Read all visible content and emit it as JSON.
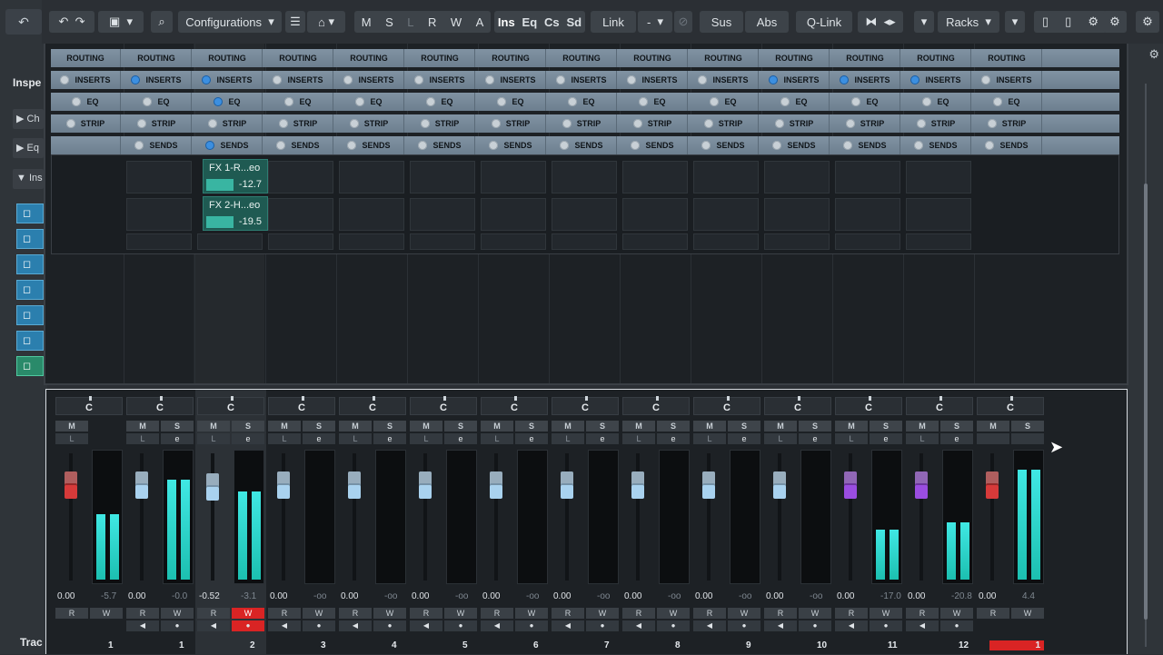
{
  "toolbar": {
    "configurations": "Configurations",
    "mode_buttons": [
      "M",
      "S",
      "L",
      "R",
      "W",
      "A"
    ],
    "view_buttons": [
      "Ins",
      "Eq",
      "Cs",
      "Sd"
    ],
    "link": "Link",
    "link_value": "-",
    "sus": "Sus",
    "abs": "Abs",
    "qlink": "Q-Link",
    "racks": "Racks"
  },
  "left_panel": {
    "title": "Inspe",
    "sections": [
      "Ch",
      "Eq",
      "Ins"
    ],
    "footer": "Trac"
  },
  "rack": {
    "routing": "ROUTING",
    "inserts": "INSERTS",
    "eq": "EQ",
    "strip": "STRIP",
    "sends": "SENDS",
    "inserts_active": [
      1,
      2,
      10,
      11,
      12
    ],
    "eq_active": [
      2
    ],
    "sends_active": [
      2
    ]
  },
  "sends": [
    {
      "name": "FX 1-R...eo",
      "value": "-12.7"
    },
    {
      "name": "FX 2-H...eo",
      "value": "-19.5"
    }
  ],
  "channels": [
    {
      "pan": "C",
      "volume": "0.00",
      "peak": "-5.7",
      "num": "1",
      "fader": "red",
      "meter": 0.52
    },
    {
      "pan": "C",
      "volume": "0.00",
      "peak": "-0.0",
      "num": "1",
      "fader": "blue",
      "meter": 0.8
    },
    {
      "pan": "C",
      "volume": "-0.52",
      "peak": "-3.1",
      "num": "2",
      "fader": "blue",
      "meter": 0.7
    },
    {
      "pan": "C",
      "volume": "0.00",
      "peak": "-oo",
      "num": "3",
      "fader": "blue",
      "meter": 0
    },
    {
      "pan": "C",
      "volume": "0.00",
      "peak": "-oo",
      "num": "4",
      "fader": "blue",
      "meter": 0
    },
    {
      "pan": "C",
      "volume": "0.00",
      "peak": "-oo",
      "num": "5",
      "fader": "blue",
      "meter": 0
    },
    {
      "pan": "C",
      "volume": "0.00",
      "peak": "-oo",
      "num": "6",
      "fader": "blue",
      "meter": 0
    },
    {
      "pan": "C",
      "volume": "0.00",
      "peak": "-oo",
      "num": "7",
      "fader": "blue",
      "meter": 0
    },
    {
      "pan": "C",
      "volume": "0.00",
      "peak": "-oo",
      "num": "8",
      "fader": "blue",
      "meter": 0
    },
    {
      "pan": "C",
      "volume": "0.00",
      "peak": "-oo",
      "num": "9",
      "fader": "blue",
      "meter": 0
    },
    {
      "pan": "C",
      "volume": "0.00",
      "peak": "-oo",
      "num": "10",
      "fader": "blue",
      "meter": 0
    },
    {
      "pan": "C",
      "volume": "0.00",
      "peak": "-17.0",
      "num": "11",
      "fader": "purple",
      "meter": 0.4
    },
    {
      "pan": "C",
      "volume": "0.00",
      "peak": "-20.8",
      "num": "12",
      "fader": "purple",
      "meter": 0.46
    },
    {
      "pan": "C",
      "volume": "0.00",
      "peak": "4.4",
      "num": "1",
      "fader": "red",
      "meter": 0.88
    }
  ],
  "labels": {
    "mute": "M",
    "solo": "S",
    "listen": "L",
    "read": "R",
    "write": "W",
    "edit": "e"
  },
  "colors": {
    "fader_red": "#d63a3a",
    "fader_blue": "#a9d2ef",
    "fader_purple": "#9a4de0",
    "meter": "#2fd9d0",
    "record": "#d92424",
    "rack_header": "#7688998"
  }
}
